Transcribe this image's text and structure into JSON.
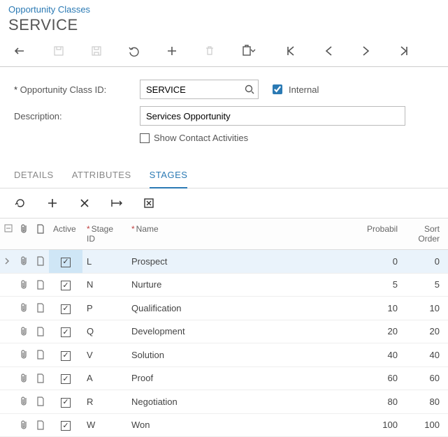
{
  "breadcrumb": "Opportunity Classes",
  "title": "SERVICE",
  "form": {
    "class_id_label": "Opportunity Class ID:",
    "class_id_value": "SERVICE",
    "internal_label": "Internal",
    "internal_checked": true,
    "description_label": "Description:",
    "description_value": "Services Opportunity",
    "show_contact_label": "Show Contact Activities",
    "show_contact_checked": false
  },
  "tabs": [
    {
      "label": "DETAILS",
      "active": false
    },
    {
      "label": "ATTRIBUTES",
      "active": false
    },
    {
      "label": "STAGES",
      "active": true
    }
  ],
  "grid": {
    "headers": {
      "active": "Active",
      "stage_id": "Stage ID",
      "name": "Name",
      "probability": "Probabil",
      "sort_order": "Sort Order"
    },
    "rows": [
      {
        "active": true,
        "stage_id": "L",
        "name": "Prospect",
        "prob": 0,
        "sort": 0,
        "selected": true
      },
      {
        "active": true,
        "stage_id": "N",
        "name": "Nurture",
        "prob": 5,
        "sort": 5,
        "selected": false
      },
      {
        "active": true,
        "stage_id": "P",
        "name": "Qualification",
        "prob": 10,
        "sort": 10,
        "selected": false
      },
      {
        "active": true,
        "stage_id": "Q",
        "name": "Development",
        "prob": 20,
        "sort": 20,
        "selected": false
      },
      {
        "active": true,
        "stage_id": "V",
        "name": "Solution",
        "prob": 40,
        "sort": 40,
        "selected": false
      },
      {
        "active": true,
        "stage_id": "A",
        "name": "Proof",
        "prob": 60,
        "sort": 60,
        "selected": false
      },
      {
        "active": true,
        "stage_id": "R",
        "name": "Negotiation",
        "prob": 80,
        "sort": 80,
        "selected": false
      },
      {
        "active": true,
        "stage_id": "W",
        "name": "Won",
        "prob": 100,
        "sort": 100,
        "selected": false
      }
    ]
  }
}
